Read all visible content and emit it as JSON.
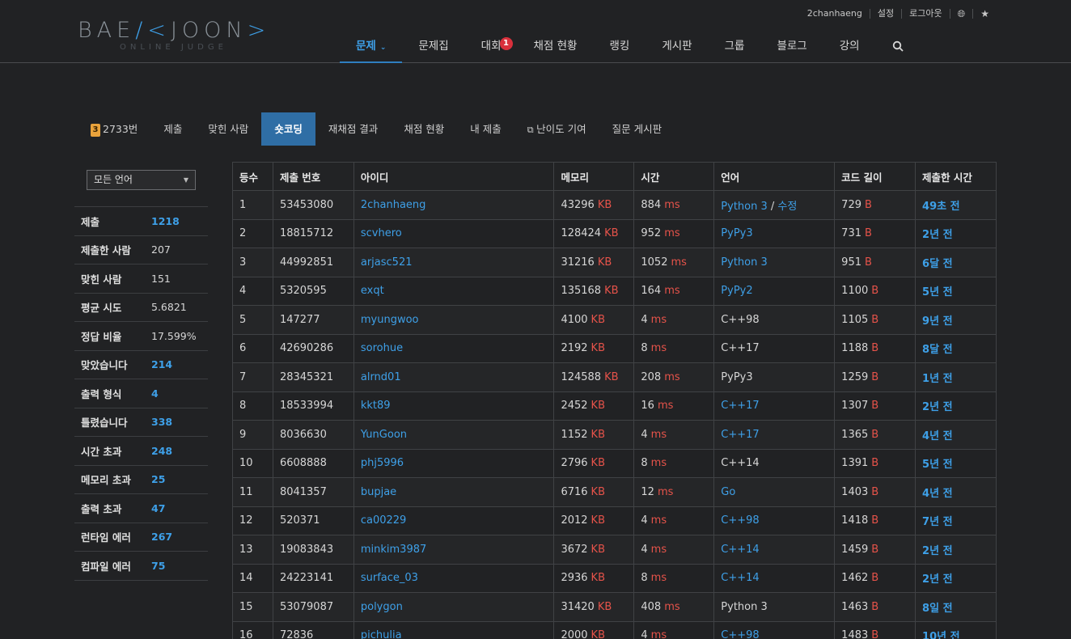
{
  "header": {
    "logo_left": "BAE",
    "logo_mid": "K",
    "logo_right": "JOON",
    "logo_sub": "ONLINE JUDGE",
    "top_links": [
      "2chanhaeng",
      "설정",
      "로그아웃"
    ],
    "nav": [
      {
        "label": "문제",
        "active": true
      },
      {
        "label": "문제집"
      },
      {
        "label": "대회",
        "badge": "1"
      },
      {
        "label": "채점 현황"
      },
      {
        "label": "랭킹"
      },
      {
        "label": "게시판"
      },
      {
        "label": "그룹"
      },
      {
        "label": "블로그"
      },
      {
        "label": "강의"
      }
    ]
  },
  "problem_menu": {
    "level": "3",
    "problem": "2733번",
    "items": [
      "제출",
      "맞힌 사람",
      "숏코딩",
      "재채점 결과",
      "채점 현황",
      "내 제출",
      "난이도 기여",
      "질문 게시판"
    ],
    "active_index": 2
  },
  "sidebar": {
    "language_select": "모든 언어",
    "stats": [
      {
        "label": "제출",
        "value": "1218",
        "link": true
      },
      {
        "label": "제출한 사람",
        "value": "207",
        "link": false
      },
      {
        "label": "맞힌 사람",
        "value": "151",
        "link": false
      },
      {
        "label": "평균 시도",
        "value": "5.6821",
        "link": false
      },
      {
        "label": "정답 비율",
        "value": "17.599%",
        "link": false
      },
      {
        "label": "맞았습니다",
        "value": "214",
        "link": true
      },
      {
        "label": "출력 형식",
        "value": "4",
        "link": true
      },
      {
        "label": "틀렸습니다",
        "value": "338",
        "link": true
      },
      {
        "label": "시간 초과",
        "value": "248",
        "link": true
      },
      {
        "label": "메모리 초과",
        "value": "25",
        "link": true
      },
      {
        "label": "출력 초과",
        "value": "47",
        "link": true
      },
      {
        "label": "런타임 에러",
        "value": "267",
        "link": true
      },
      {
        "label": "컴파일 에러",
        "value": "75",
        "link": true
      }
    ]
  },
  "table": {
    "headers": [
      "등수",
      "제출 번호",
      "아이디",
      "메모리",
      "시간",
      "언어",
      "코드 길이",
      "제출한 시간"
    ],
    "units": {
      "memory": "KB",
      "time": "ms",
      "length": "B"
    },
    "rows": [
      {
        "rank": "1",
        "id": "53453080",
        "user": "2chanhaeng",
        "mem": "43296",
        "time": "884",
        "lang": "Python 3",
        "lang_link": true,
        "edit": "수정",
        "len": "729",
        "when": "49초 전"
      },
      {
        "rank": "2",
        "id": "18815712",
        "user": "scvhero",
        "mem": "128424",
        "time": "952",
        "lang": "PyPy3",
        "lang_link": true,
        "len": "731",
        "when": "2년 전"
      },
      {
        "rank": "3",
        "id": "44992851",
        "user": "arjasc521",
        "mem": "31216",
        "time": "1052",
        "lang": "Python 3",
        "lang_link": true,
        "len": "951",
        "when": "6달 전"
      },
      {
        "rank": "4",
        "id": "5320595",
        "user": "exqt",
        "mem": "135168",
        "time": "164",
        "lang": "PyPy2",
        "lang_link": true,
        "len": "1100",
        "when": "5년 전"
      },
      {
        "rank": "5",
        "id": "147277",
        "user": "myungwoo",
        "mem": "4100",
        "time": "4",
        "lang": "C++98",
        "lang_link": false,
        "len": "1105",
        "when": "9년 전"
      },
      {
        "rank": "6",
        "id": "42690286",
        "user": "sorohue",
        "mem": "2192",
        "time": "8",
        "lang": "C++17",
        "lang_link": false,
        "len": "1188",
        "when": "8달 전"
      },
      {
        "rank": "7",
        "id": "28345321",
        "user": "alrnd01",
        "mem": "124588",
        "time": "208",
        "lang": "PyPy3",
        "lang_link": false,
        "len": "1259",
        "when": "1년 전"
      },
      {
        "rank": "8",
        "id": "18533994",
        "user": "kkt89",
        "mem": "2452",
        "time": "16",
        "lang": "C++17",
        "lang_link": true,
        "len": "1307",
        "when": "2년 전"
      },
      {
        "rank": "9",
        "id": "8036630",
        "user": "YunGoon",
        "mem": "1152",
        "time": "4",
        "lang": "C++17",
        "lang_link": true,
        "len": "1365",
        "when": "4년 전"
      },
      {
        "rank": "10",
        "id": "6608888",
        "user": "phj5996",
        "mem": "2796",
        "time": "8",
        "lang": "C++14",
        "lang_link": false,
        "len": "1391",
        "when": "5년 전"
      },
      {
        "rank": "11",
        "id": "8041357",
        "user": "bupjae",
        "mem": "6716",
        "time": "12",
        "lang": "Go",
        "lang_link": true,
        "len": "1403",
        "when": "4년 전"
      },
      {
        "rank": "12",
        "id": "520371",
        "user": "ca00229",
        "mem": "2012",
        "time": "4",
        "lang": "C++98",
        "lang_link": true,
        "len": "1418",
        "when": "7년 전"
      },
      {
        "rank": "13",
        "id": "19083843",
        "user": "minkim3987",
        "mem": "3672",
        "time": "4",
        "lang": "C++14",
        "lang_link": true,
        "len": "1459",
        "when": "2년 전"
      },
      {
        "rank": "14",
        "id": "24223141",
        "user": "surface_03",
        "mem": "2936",
        "time": "8",
        "lang": "C++14",
        "lang_link": true,
        "len": "1462",
        "when": "2년 전"
      },
      {
        "rank": "15",
        "id": "53079087",
        "user": "polygon",
        "mem": "31420",
        "time": "408",
        "lang": "Python 3",
        "lang_link": false,
        "len": "1463",
        "when": "8일 전"
      },
      {
        "rank": "16",
        "id": "72836",
        "user": "pichulia",
        "mem": "2000",
        "time": "4",
        "lang": "C++98",
        "lang_link": true,
        "len": "1483",
        "when": "10년 전"
      }
    ]
  }
}
